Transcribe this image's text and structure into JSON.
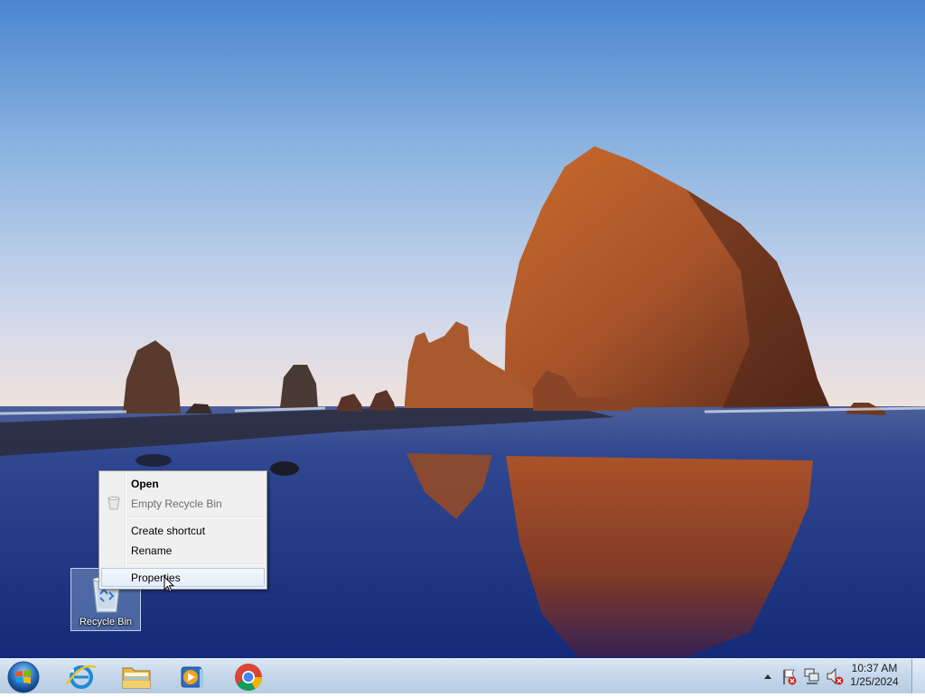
{
  "desktop": {
    "wallpaper": "coastal-sea-stack-sunset",
    "icons": [
      {
        "label": "Recycle Bin",
        "icon": "recycle-bin-icon"
      }
    ]
  },
  "context_menu": {
    "items": [
      {
        "label": "Open",
        "style": "bold"
      },
      {
        "label": "Empty Recycle Bin",
        "style": "disabled"
      },
      {
        "label": "Create shortcut",
        "style": "normal"
      },
      {
        "label": "Rename",
        "style": "normal"
      },
      {
        "label": "Properties",
        "style": "highlighted"
      }
    ]
  },
  "taskbar": {
    "start_icon": "windows-start-orb-icon",
    "pinned": [
      {
        "name": "Internet Explorer",
        "icon": "internet-explorer-icon"
      },
      {
        "name": "Windows Explorer",
        "icon": "file-explorer-icon"
      },
      {
        "name": "Windows Media Player",
        "icon": "media-player-icon"
      },
      {
        "name": "Google Chrome",
        "icon": "chrome-icon"
      }
    ],
    "tray_icons": [
      "show-hidden-icons-icon",
      "action-center-flag-icon",
      "network-icon",
      "volume-muted-icon"
    ],
    "clock": {
      "time": "10:37 AM",
      "date": "1/25/2024"
    }
  },
  "colors": {
    "sky_top": "#4a86d0",
    "rock": "#b3592a",
    "water": "#1d3380",
    "menu_bg": "#f0f0f0",
    "menu_highlight_border": "#aeccf0",
    "taskbar": "#c6d8eb"
  }
}
